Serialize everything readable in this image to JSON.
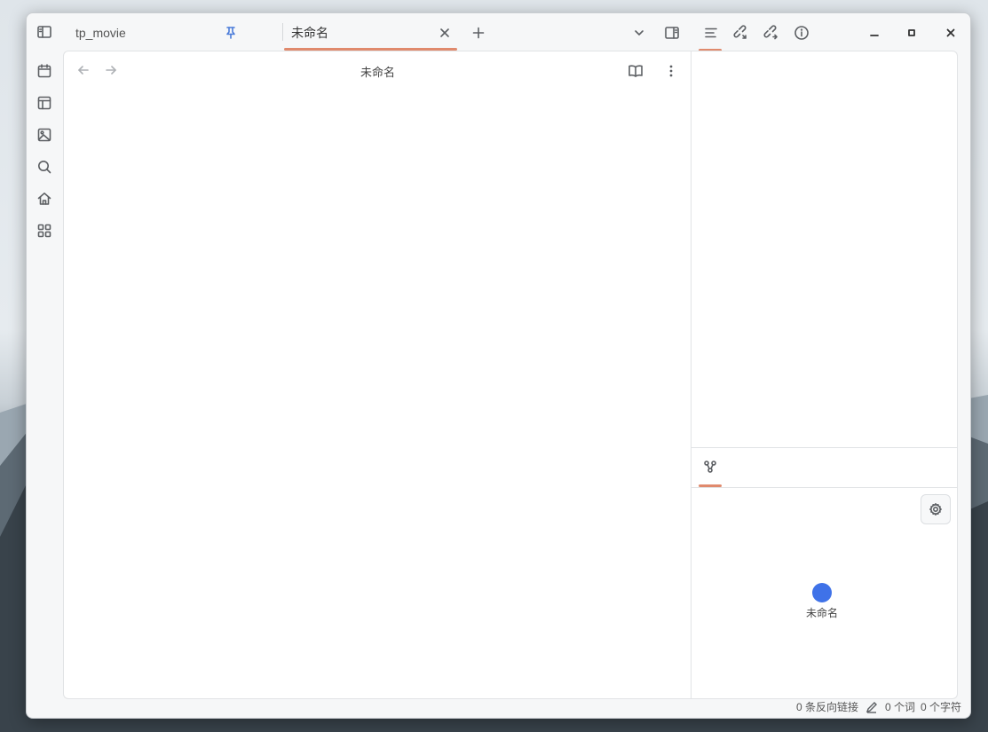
{
  "tabs": [
    {
      "label": "tp_movie",
      "pinned": true
    },
    {
      "label": "未命名",
      "active": true
    }
  ],
  "editor": {
    "title": "未命名"
  },
  "graph": {
    "node_label": "未命名",
    "node_color": "#3f72e8"
  },
  "statusbar": {
    "backlinks": "0 条反向链接",
    "words": "0 个词",
    "chars": "0 个字符"
  },
  "colors": {
    "accent": "#e08a6d"
  },
  "icons": {
    "ribbon": [
      "sidebar-toggle-icon",
      "calendar-icon",
      "layout-icon",
      "image-icon",
      "search-icon",
      "home-icon",
      "dashboard-icon"
    ],
    "right_tabs": [
      "outline-icon",
      "backlinks-icon",
      "outgoing-links-icon",
      "info-icon"
    ]
  }
}
